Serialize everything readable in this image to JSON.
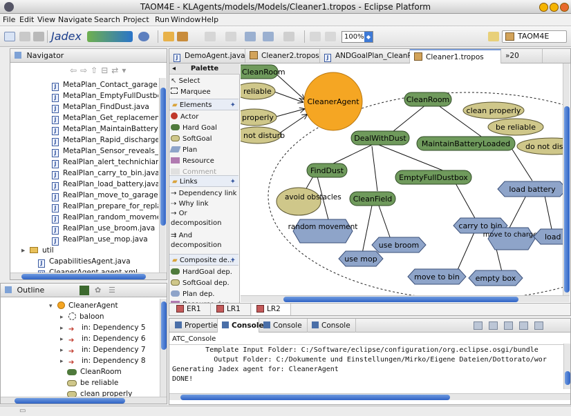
{
  "window": {
    "title": "TAOM4E - KLAgents/models/Models/Cleaner1.tropos - Eclipse Platform"
  },
  "menu": [
    "File",
    "Edit",
    "View",
    "Navigate",
    "Search",
    "Project",
    "Run",
    "Window",
    "Help"
  ],
  "toolbar": {
    "zoom": "100%",
    "jadex_label": "Jadex",
    "perspective_label": "TAOM4E"
  },
  "navigator": {
    "title": "Navigator",
    "items": [
      {
        "label": "MetaPlan_Contact_garage.java",
        "icon": "java-file-icon"
      },
      {
        "label": "MetaPlan_EmptyFullDustbox.java",
        "icon": "java-file-icon"
      },
      {
        "label": "MetaPlan_FindDust.java",
        "icon": "java-file-icon"
      },
      {
        "label": "MetaPlan_Get_replacement.java",
        "icon": "java-file-icon"
      },
      {
        "label": "MetaPlan_MaintainBatteryLoaded",
        "icon": "java-file-icon"
      },
      {
        "label": "MetaPlan_Rapid_discharge.java",
        "icon": "java-file-icon"
      },
      {
        "label": "MetaPlan_Sensor_reveals_obj_in",
        "icon": "java-file-icon"
      },
      {
        "label": "RealPlan_alert_technichian.java",
        "icon": "java-file-icon"
      },
      {
        "label": "RealPlan_carry_to_bin.java",
        "icon": "java-file-icon"
      },
      {
        "label": "RealPlan_load_battery.java",
        "icon": "java-file-icon"
      },
      {
        "label": "RealPlan_move_to_garage.java",
        "icon": "java-file-icon"
      },
      {
        "label": "RealPlan_prepare_for_replaceme",
        "icon": "java-file-icon"
      },
      {
        "label": "RealPlan_random_movement.java",
        "icon": "java-file-icon"
      },
      {
        "label": "RealPlan_use_broom.java",
        "icon": "java-file-icon"
      },
      {
        "label": "RealPlan_use_mop.java",
        "icon": "java-file-icon"
      },
      {
        "label": "util",
        "icon": "folder-icon"
      },
      {
        "label": "CapabilitiesAgent.java",
        "icon": "java-file-icon"
      },
      {
        "label": "CleanerAgent.agent.xml",
        "icon": "xml-file-icon"
      }
    ]
  },
  "outline": {
    "title": "Outline",
    "items": [
      {
        "label": "CleanerAgent"
      },
      {
        "label": "baloon"
      },
      {
        "label": "in: Dependency 5"
      },
      {
        "label": "in: Dependency 6"
      },
      {
        "label": "in: Dependency 7"
      },
      {
        "label": "in: Dependency 8"
      },
      {
        "label": "CleanRoom"
      },
      {
        "label": "be reliable"
      },
      {
        "label": "clean properly"
      }
    ]
  },
  "editor_tabs": [
    {
      "label": "DemoAgent.java"
    },
    {
      "label": "Cleaner2.tropos"
    },
    {
      "label": "ANDGoalPlan_CleanRoo"
    },
    {
      "label": "Cleaner1.tropos"
    },
    {
      "label": "»20"
    }
  ],
  "palette": {
    "title": "Palette",
    "select": "Select",
    "marquee": "Marquee",
    "elements_title": "Elements",
    "elements": [
      "Actor",
      "Hard Goal",
      "SoftGoal",
      "Plan",
      "Resource",
      "Comment"
    ],
    "links_title": "Links",
    "links": [
      "Dependency link",
      "Why link",
      "Or decomposition",
      "And decomposition"
    ],
    "composite_title": "Composite de...",
    "composite": [
      "HardGoal dep.",
      "SoftGoal dep.",
      "Plan dep.",
      "Resource dep."
    ]
  },
  "diagram": {
    "actor": "CleanerAgent",
    "left_nodes": [
      "CleanRoom",
      "reliable",
      "properly",
      "not disturb"
    ],
    "hardgoals": [
      "CleanRoom",
      "DealWithDust",
      "MaintainBatteryLoaded",
      "FindDust",
      "EmptyFullDustbox",
      "CleanField"
    ],
    "softgoals": [
      "clean properly",
      "be reliable",
      "do not distur",
      "avoid obstacles"
    ],
    "plans": [
      "load battery",
      "random movement",
      "carry to bin",
      "use broom",
      "use mop",
      "move to charger",
      "load til",
      "move to bin",
      "empty box"
    ]
  },
  "bottom_tabs": [
    {
      "label": "ER1"
    },
    {
      "label": "LR1"
    },
    {
      "label": "LR2"
    }
  ],
  "console": {
    "tabs": [
      {
        "label": "Properties"
      },
      {
        "label": "Console"
      },
      {
        "label": "Console"
      },
      {
        "label": "Console"
      }
    ],
    "name": "ATC_Console",
    "lines": [
      "        Template Input Folder: C:/Software/eclipse/configuration/org.eclipse.osgi/bundle",
      "          Output Folder: C:/Dokumente und Einstellungen/Mirko/Eigene Dateien/Dottorato/wor",
      "Generating Jadex agent for: CleanerAgent",
      "DONE!"
    ]
  },
  "colors": {
    "hardgoal": "#6f9a5c",
    "softgoal": "#cfc78a",
    "plan": "#8ea4c9",
    "actor": "#f5a623",
    "scroll": "#2f62c4"
  }
}
